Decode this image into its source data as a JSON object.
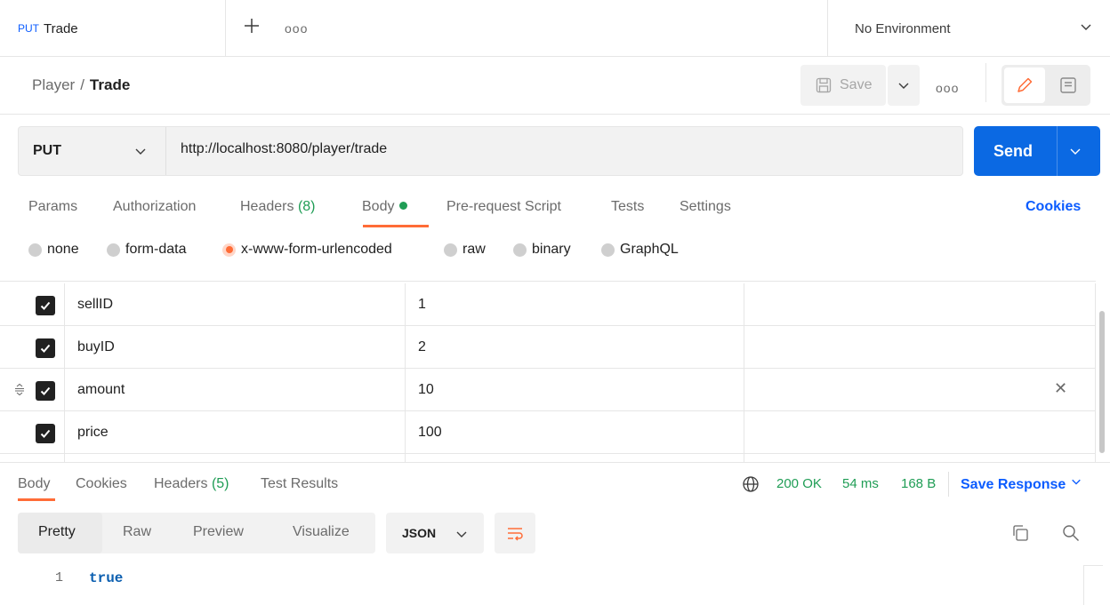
{
  "tabs": {
    "active_tab": {
      "method": "PUT",
      "name": "Trade"
    },
    "more_label": "ooo",
    "environment": "No Environment"
  },
  "header": {
    "breadcrumb_parent": "Player",
    "breadcrumb_separator": "/",
    "breadcrumb_current": "Trade",
    "save_label": "Save",
    "more_label": "ooo"
  },
  "request": {
    "method": "PUT",
    "url": "http://localhost:8080/player/trade",
    "send_label": "Send"
  },
  "request_tabs": {
    "params": "Params",
    "authorization": "Authorization",
    "headers": "Headers",
    "headers_count": "(8)",
    "body": "Body",
    "pre_request": "Pre-request Script",
    "tests": "Tests",
    "settings": "Settings",
    "cookies": "Cookies",
    "active": "Body"
  },
  "body_types": {
    "none": "none",
    "form_data": "form-data",
    "urlencoded": "x-www-form-urlencoded",
    "raw": "raw",
    "binary": "binary",
    "graphql": "GraphQL",
    "selected": "x-www-form-urlencoded"
  },
  "params": [
    {
      "checked": true,
      "key": "sellID",
      "value": "1",
      "description": ""
    },
    {
      "checked": true,
      "key": "buyID",
      "value": "2",
      "description": ""
    },
    {
      "checked": true,
      "key": "amount",
      "value": "10",
      "description": ""
    },
    {
      "checked": true,
      "key": "price",
      "value": "100",
      "description": ""
    }
  ],
  "response": {
    "tabs": {
      "body": "Body",
      "cookies": "Cookies",
      "headers": "Headers",
      "headers_count": "(5)",
      "test_results": "Test Results"
    },
    "status": "200 OK",
    "time": "54 ms",
    "size": "168 B",
    "save_response": "Save Response",
    "views": {
      "pretty": "Pretty",
      "raw": "Raw",
      "preview": "Preview",
      "visualize": "Visualize",
      "active": "Pretty"
    },
    "format": "JSON",
    "lines": [
      {
        "number": "1",
        "text": "true"
      }
    ]
  },
  "colors": {
    "accent_orange": "#ff6c37",
    "link_blue": "#0b5cff",
    "send_blue": "#0b69e3",
    "success_green": "#1f9d55"
  }
}
